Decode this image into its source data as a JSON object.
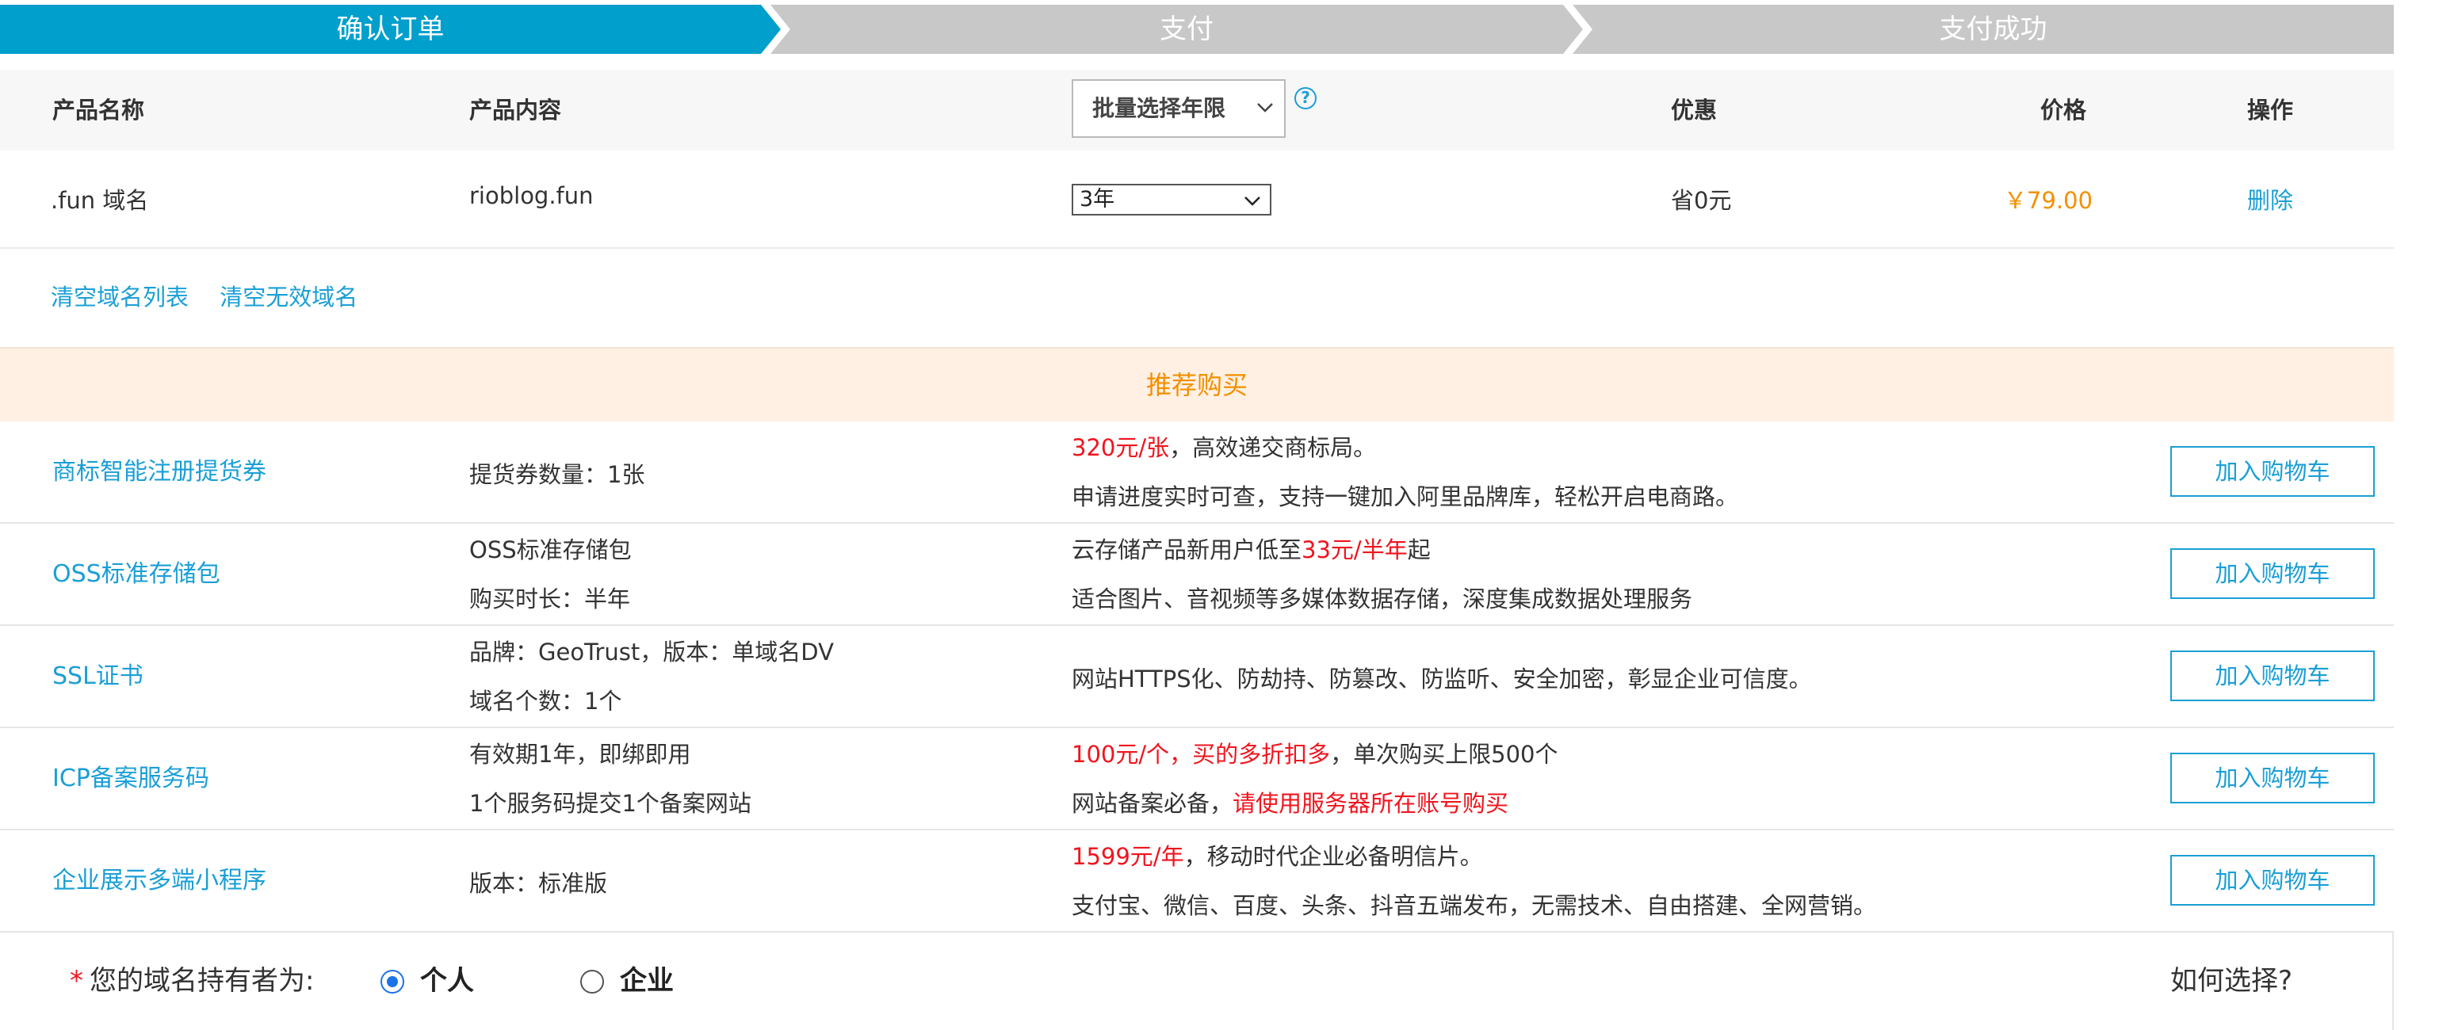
{
  "steps": [
    {
      "label": "确认订单",
      "active": true
    },
    {
      "label": "支付",
      "active": false
    },
    {
      "label": "支付成功",
      "active": false
    }
  ],
  "colors": {
    "accent": "#009fcc",
    "inactive": "#c8c8c8",
    "price": "#f39000",
    "link": "#1a9fd6",
    "highlight": "#f0141e"
  },
  "table": {
    "headers": {
      "name": "产品名称",
      "content": "产品内容",
      "batch_select": "批量选择年限",
      "discount": "优惠",
      "price": "价格",
      "action": "操作"
    },
    "row": {
      "name": ".fun 域名",
      "content": "rioblog.fun",
      "years": "3年",
      "discount": "省0元",
      "price": "￥79.00",
      "action": "删除"
    }
  },
  "links": {
    "clear_list": "清空域名列表",
    "clear_invalid": "清空无效域名"
  },
  "recommend": {
    "title": "推荐购买",
    "cart_label": "加入购物车",
    "items": [
      {
        "name": "商标智能注册提货券",
        "content": [
          "提货券数量：1张"
        ],
        "desc1_red": "320元/张",
        "desc1_rest": "，高效递交商标局。",
        "desc2_pre": "申请进度实时可查，支持一键加入阿里品牌库，轻松开启电商路。",
        "desc2_red": ""
      },
      {
        "name": "OSS标准存储包",
        "content": [
          "OSS标准存储包",
          "购买时长：半年"
        ],
        "desc1_pre": "云存储产品新用户低至",
        "desc1_red": "33元/半年",
        "desc1_rest": "起",
        "desc2_pre": "适合图片、音视频等多媒体数据存储，深度集成数据处理服务"
      },
      {
        "name": "SSL证书",
        "content": [
          "品牌：GeoTrust，版本：单域名DV",
          "域名个数：1个"
        ],
        "desc1_rest": "网站HTTPS化、防劫持、防篡改、防监听、安全加密，彰显企业可信度。"
      },
      {
        "name": "ICP备案服务码",
        "content": [
          "有效期1年，即绑即用",
          "1个服务码提交1个备案网站"
        ],
        "desc1_red": "100元/个，买的多折扣多",
        "desc1_rest": "，单次购买上限500个",
        "desc2_pre": "网站备案必备，",
        "desc2_red": "请使用服务器所在账号购买"
      },
      {
        "name": "企业展示多端小程序",
        "content": [
          "版本：标准版"
        ],
        "desc1_red": "1599元/年",
        "desc1_rest": "，移动时代企业必备明信片。",
        "desc2_pre": "支付宝、微信、百度、头条、抖音五端发布，无需技术、自由搭建、全网营销。"
      }
    ]
  },
  "owner": {
    "required_mark": "*",
    "label": "您的域名持有者为:",
    "option_personal": "个人",
    "option_company": "企业",
    "selected": "个人",
    "help": "如何选择?"
  }
}
